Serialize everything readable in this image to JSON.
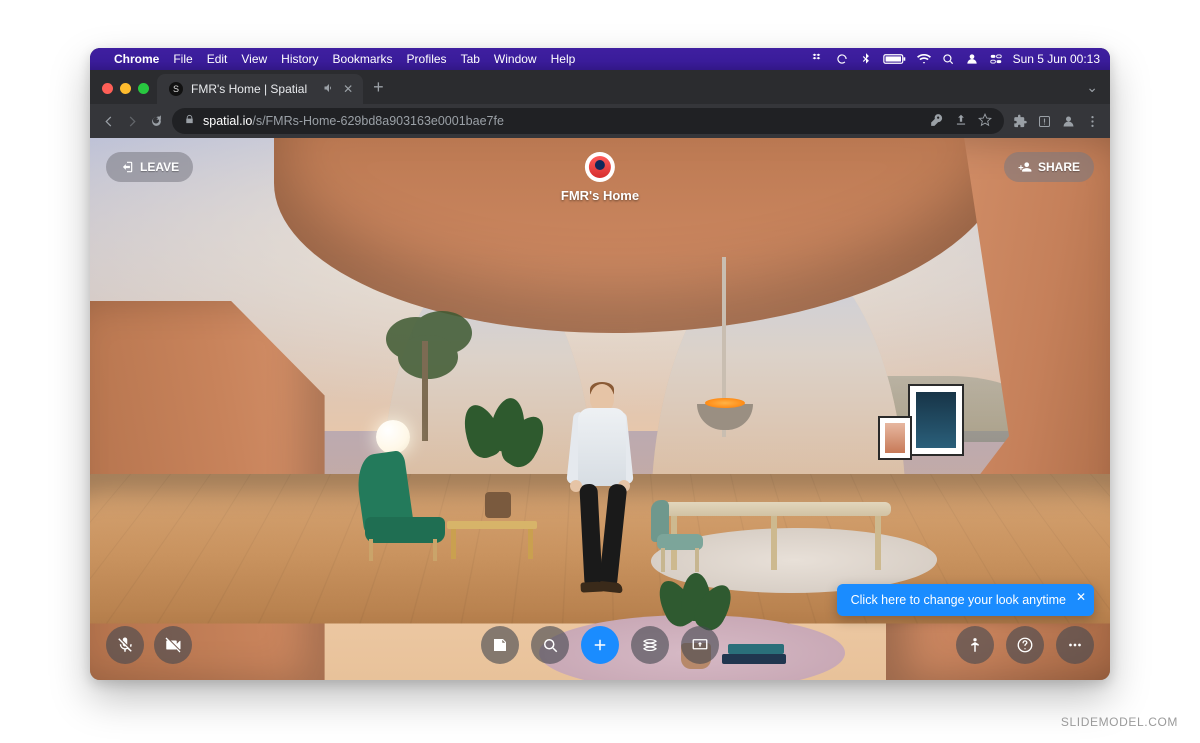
{
  "menubar": {
    "app": "Chrome",
    "items": [
      "File",
      "Edit",
      "View",
      "History",
      "Bookmarks",
      "Profiles",
      "Tab",
      "Window",
      "Help"
    ],
    "clock": "Sun 5 Jun  00:13"
  },
  "browser": {
    "tab_title": "FMR's Home | Spatial",
    "url_host": "spatial.io",
    "url_path": "/s/FMRs-Home-629bd8a903163e0001bae7fe"
  },
  "app": {
    "leave_label": "LEAVE",
    "share_label": "SHARE",
    "space_name": "FMR's Home",
    "tooltip_text": "Click here to change your look anytime"
  },
  "watermark": "SLIDEMODEL.COM"
}
